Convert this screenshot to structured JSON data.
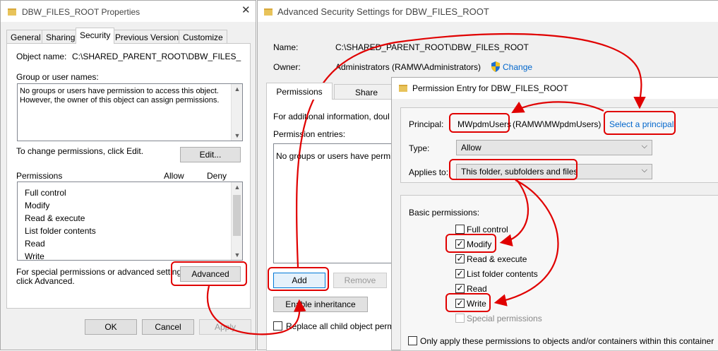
{
  "props": {
    "title": "DBW_FILES_ROOT Properties",
    "close": "✕",
    "tabs": [
      "General",
      "Sharing",
      "Security",
      "Previous Versions",
      "Customize"
    ],
    "object_label": "Object name:",
    "object_value": "C:\\SHARED_PARENT_ROOT\\DBW_FILES_ROOT",
    "group_label": "Group or user names:",
    "group_text_1": "No groups or users have permission to access this object.",
    "group_text_2": "However, the owner of this object can assign permissions.",
    "change_text": "To change permissions, click Edit.",
    "edit_btn": "Edit...",
    "perm_label": "Permissions",
    "allow": "Allow",
    "deny": "Deny",
    "perms": [
      "Full control",
      "Modify",
      "Read & execute",
      "List folder contents",
      "Read",
      "Write"
    ],
    "special_1": "For special permissions or advanced settings,",
    "special_2": "click Advanced.",
    "advanced_btn": "Advanced",
    "ok": "OK",
    "cancel": "Cancel",
    "apply": "Apply"
  },
  "adv": {
    "title": "Advanced Security Settings for DBW_FILES_ROOT",
    "name_label": "Name:",
    "name_value": "C:\\SHARED_PARENT_ROOT\\DBW_FILES_ROOT",
    "owner_label": "Owner:",
    "owner_value": "Administrators (RAMW\\Administrators)",
    "change": "Change",
    "tabs": [
      "Permissions",
      "Share"
    ],
    "info": "For additional information, doul",
    "entries_label": "Permission entries:",
    "entries_text": "No groups or users have permis",
    "add": "Add",
    "remove": "Remove",
    "enable_inh": "Enable inheritance",
    "replace": "Replace all child object permi"
  },
  "entry": {
    "title": "Permission Entry for DBW_FILES_ROOT",
    "principal_label": "Principal:",
    "principal_name": "MWpdmUsers",
    "principal_full": "(RAMW\\MWpdmUsers)",
    "select_principal": "Select a principal",
    "type_label": "Type:",
    "type_value": "Allow",
    "applies_label": "Applies to:",
    "applies_value": "This folder, subfolders and files",
    "basic_label": "Basic permissions:",
    "perms": [
      {
        "label": "Full control",
        "check": ""
      },
      {
        "label": "Modify",
        "check": "✓"
      },
      {
        "label": "Read & execute",
        "check": "✓"
      },
      {
        "label": "List folder contents",
        "check": "✓"
      },
      {
        "label": "Read",
        "check": "✓"
      },
      {
        "label": "Write",
        "check": "✓"
      },
      {
        "label": "Special permissions",
        "check": ""
      }
    ],
    "only_apply": "Only apply these permissions to objects and/or containers within this container"
  },
  "colors": {
    "highlight": "#e00000",
    "link": "#0066cc"
  }
}
